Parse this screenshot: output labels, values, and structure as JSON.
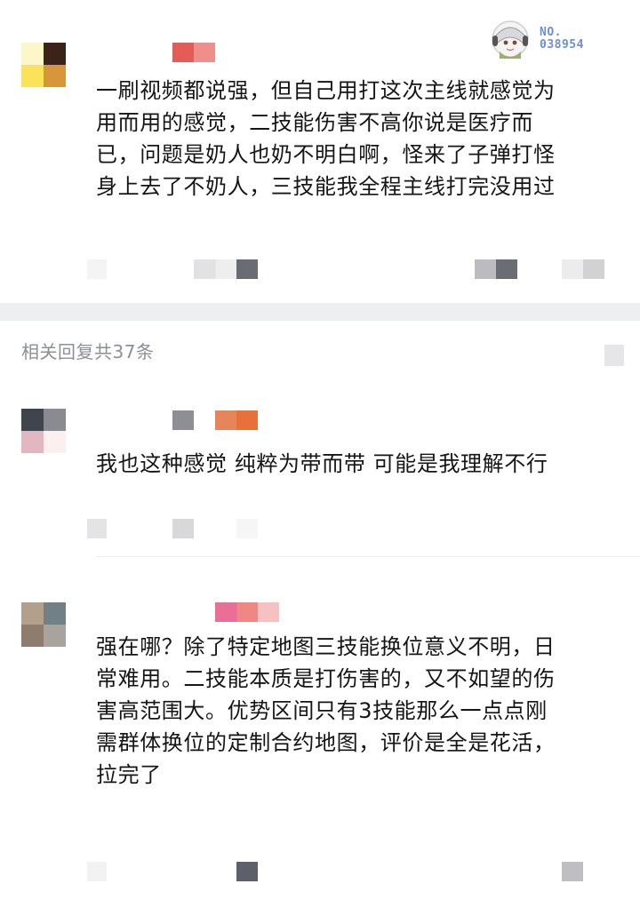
{
  "comments": [
    {
      "text": "一刷视频都说强，但自己用打这次主线就感觉为\n用而用的感觉，二技能伤害不高你说是医疗而\n已，问题是奶人也奶不明白啊，怪来了子弹打怪\n身上去了不奶人，三技能我全程主线打完没用过"
    },
    {
      "text": "我也这种感觉 纯粹为带而带 可能是我理解不行"
    },
    {
      "text": "强在哪？除了特定地图三技能换位意义不明，日\n常难用。二技能本质是打伤害的，又不如望的伤\n害高范围大。优势区间只有3技能那么一点点刚\n需群体换位的定制合约地图，评价是全是花活，\n拉完了"
    }
  ],
  "reply_count_label": "相关回复共37条",
  "badge": {
    "line1": "NO.",
    "line2": "038954",
    "color": "#6a8fd8"
  },
  "colors": {
    "text": "#151515",
    "muted": "#8a8f99",
    "separator": "#eeeff1",
    "background": "#ffffff"
  }
}
